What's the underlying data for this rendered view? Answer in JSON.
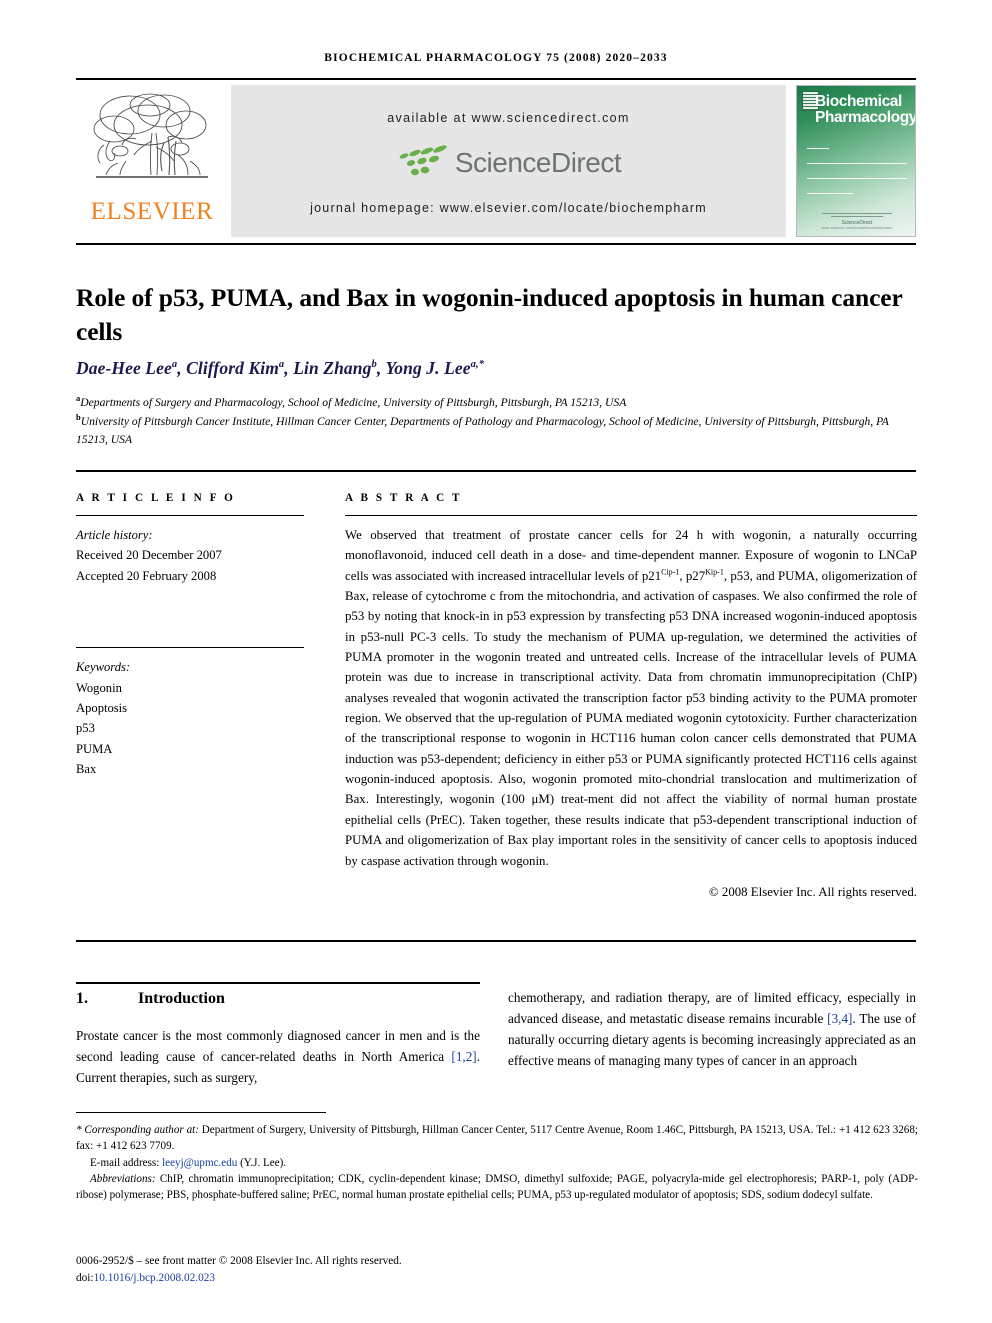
{
  "running_head": "BIOCHEMICAL PHARMACOLOGY 75 (2008) 2020–2033",
  "masthead": {
    "publisher_name": "ELSEVIER",
    "available_at": "available at www.sciencedirect.com",
    "sciencedirect_wordmark": "ScienceDirect",
    "journal_homepage": "journal homepage: www.elsevier.com/locate/biochempharm",
    "cover": {
      "line1": "Biochemical",
      "line2": "Pharmacology",
      "footer_brand": "ScienceDirect",
      "footer_url": "www.elsevier.com/locate/biochempharm"
    },
    "colors": {
      "band_background": "#e6e6e6",
      "elsevier_orange": "#F08220",
      "sciencedirect_green": "#6aaf4b",
      "sciencedirect_gray": "#6d7570",
      "cover_green": "#2e8d57"
    }
  },
  "article": {
    "title": "Role of p53, PUMA, and Bax in wogonin-induced apoptosis in human cancer cells",
    "authors_html": "Dae-Hee Lee<sup>a</sup>, Clifford Kim<sup>a</sup>, Lin Zhang<sup>b</sup>, Yong J. Lee<sup>a,*</sup>",
    "affiliations": [
      {
        "marker": "a",
        "text": "Departments of Surgery and Pharmacology, School of Medicine, University of Pittsburgh, Pittsburgh, PA 15213, USA"
      },
      {
        "marker": "b",
        "text": "University of Pittsburgh Cancer Institute, Hillman Cancer Center, Departments of Pathology and Pharmacology, School of Medicine, University of Pittsburgh, Pittsburgh, PA 15213, USA"
      }
    ]
  },
  "article_info": {
    "section_label": "A R T I C L E  I N F O",
    "history_label": "Article history:",
    "history": [
      "Received 20 December 2007",
      "Accepted 20 February 2008"
    ],
    "keywords_label": "Keywords:",
    "keywords": [
      "Wogonin",
      "Apoptosis",
      "p53",
      "PUMA",
      "Bax"
    ]
  },
  "abstract": {
    "section_label": "A B S T R A C T",
    "body_html": "We observed that treatment of prostate cancer cells for 24 h with wogonin, a naturally occurring monoflavonoid, induced cell death in a dose- and time-dependent manner. Exposure of wogonin to LNCaP cells was associated with increased intracellular levels of p21<sup>Cip-1</sup>, p27<sup>Kip-1</sup>, p53, and PUMA, oligomerization of Bax, release of cytochrome c from the mitochondria, and activation of caspases. We also confirmed the role of p53 by noting that knock-in in p53 expression by transfecting p53 DNA increased wogonin-induced apoptosis in p53-null PC-3 cells. To study the mechanism of PUMA up-regulation, we determined the activities of PUMA promoter in the wogonin treated and untreated cells. Increase of the intracellular levels of PUMA protein was due to increase in transcriptional activity. Data from chromatin immunoprecipitation (ChIP) analyses revealed that wogonin activated the transcription factor p53 binding activity to the PUMA promoter region. We observed that the up-regulation of PUMA mediated wogonin cytotoxicity. Further characterization of the transcriptional response to wogonin in HCT116 human colon cancer cells demonstrated that PUMA induction was p53-dependent; deficiency in either p53 or PUMA significantly protected HCT116 cells against wogonin-induced apoptosis. Also, wogonin promoted mito-chondrial translocation and multimerization of Bax. Interestingly, wogonin (100 &#956;M) treat-ment did not affect the viability of normal human prostate epithelial cells (PrEC). Taken together, these results indicate that p53-dependent transcriptional induction of PUMA and oligomerization of Bax play important roles in the sensitivity of cancer cells to apoptosis induced by caspase activation through wogonin.",
    "copyright": "© 2008 Elsevier Inc. All rights reserved."
  },
  "introduction": {
    "number": "1.",
    "heading": "Introduction",
    "column_left_html": "Prostate cancer is the most commonly diagnosed cancer in men and is the second leading cause of cancer-related deaths in North America <span class=\"ref\">[1,2]</span>. Current therapies, such as surgery,",
    "column_right_html": "chemotherapy, and radiation therapy, are of limited efficacy, especially in advanced disease, and metastatic disease remains incurable <span class=\"ref\">[3,4]</span>. The use of naturally occurring dietary agents is becoming increasingly appreciated as an effective means of managing many types of cancer in an approach"
  },
  "footnotes": {
    "corresponding_html": "<span class=\"fn-it\">* Corresponding author at:</span> Department of Surgery, University of Pittsburgh, Hillman Cancer Center, 5117 Centre Avenue, Room 1.46C, Pittsburgh, PA 15213, USA. Tel.: +1 412 623 3268; fax: +1 412 623 7709.",
    "email_html": "E-mail address: <span class=\"link\">leeyj@upmc.edu</span> (Y.J. Lee).",
    "abbreviations_html": "<span class=\"fn-it\">Abbreviations:</span> ChIP, chromatin immunoprecipitation; CDK, cyclin-dependent kinase; DMSO, dimethyl sulfoxide; PAGE, polyacryla-mide gel electrophoresis; PARP-1, poly (ADP-ribose) polymerase; PBS, phosphate-buffered saline; PrEC, normal human prostate epithelial cells; PUMA, p53 up-regulated modulator of apoptosis; SDS, sodium dodecyl sulfate.",
    "front_matter": "0006-2952/$ – see front matter © 2008 Elsevier Inc. All rights reserved.",
    "doi_label": "doi:",
    "doi_value": "10.1016/j.bcp.2008.02.023"
  }
}
